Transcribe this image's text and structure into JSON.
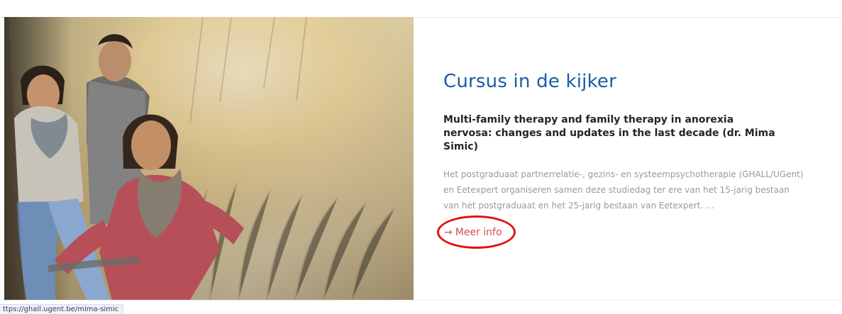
{
  "feature": {
    "heading": "Cursus in de kijker",
    "course_title": "Multi-family therapy and family therapy in anorexia nervosa: changes and updates in the last decade (dr. Mima Simic)",
    "description": "Het postgraduaat partnerrelatie-, gezins- en systeempsychotherapie (GHALL/UGent) en Eetexpert organiseren samen deze studiedag ter ere van het 15-jarig bestaan van het postgraduaat en het 25-jarig bestaan van Eetexpert. ...",
    "more_link": {
      "icon": "arrow-right-icon",
      "label": "Meer info"
    }
  },
  "status_bar": {
    "url": "ttps://ghall.ugent.be/mima-simic"
  },
  "colors": {
    "heading": "#1b5ca6",
    "link": "#d74b55",
    "annotation_circle": "#e11111"
  }
}
